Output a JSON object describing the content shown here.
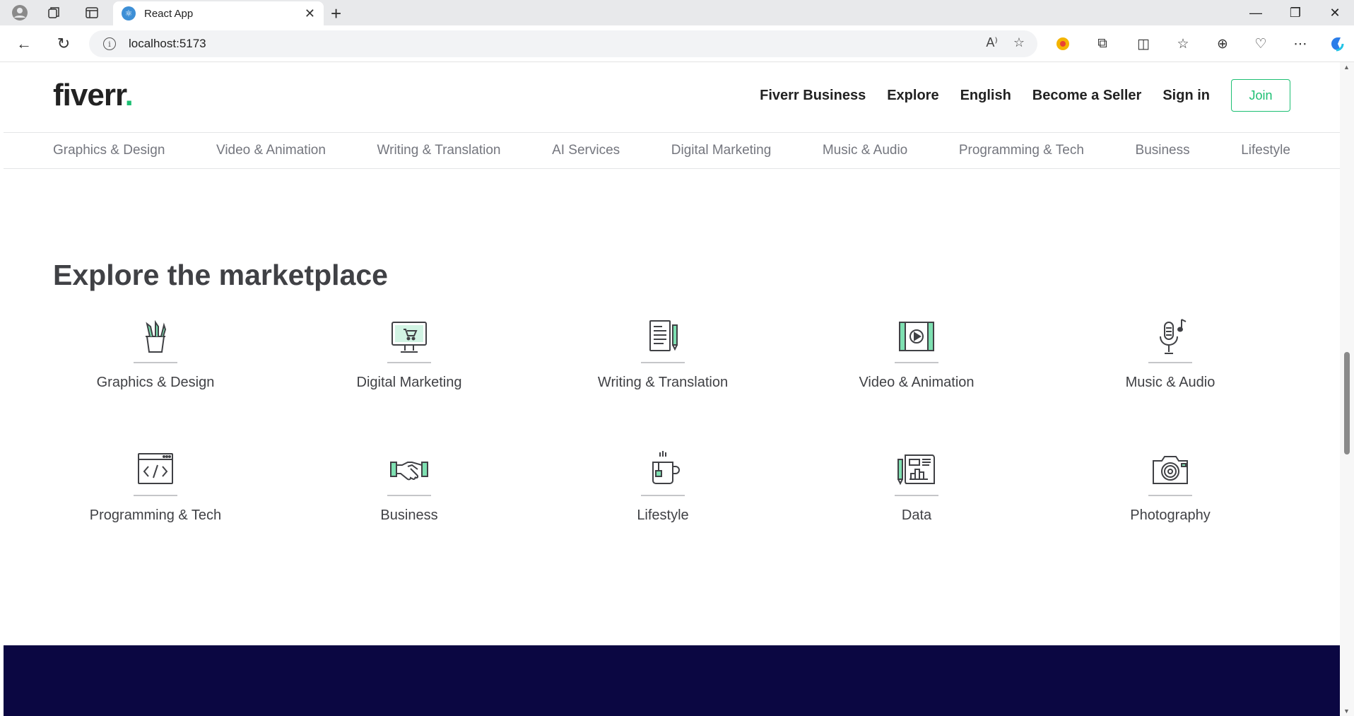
{
  "browser": {
    "tab_title": "React App",
    "url": "localhost:5173"
  },
  "header": {
    "logo_text": "fiverr",
    "logo_dot": ".",
    "nav": [
      "Fiverr Business",
      "Explore",
      "English",
      "Become a Seller",
      "Sign in"
    ],
    "join_label": "Join"
  },
  "categories": [
    "Graphics & Design",
    "Video & Animation",
    "Writing & Translation",
    "AI Services",
    "Digital Marketing",
    "Music & Audio",
    "Programming & Tech",
    "Business",
    "Lifestyle"
  ],
  "marketplace": {
    "title": "Explore the marketplace",
    "items": [
      {
        "label": "Graphics & Design",
        "icon": "pencil-cup-icon"
      },
      {
        "label": "Digital Marketing",
        "icon": "monitor-cart-icon"
      },
      {
        "label": "Writing & Translation",
        "icon": "document-pen-icon"
      },
      {
        "label": "Video & Animation",
        "icon": "film-play-icon"
      },
      {
        "label": "Music & Audio",
        "icon": "microphone-note-icon"
      },
      {
        "label": "Programming & Tech",
        "icon": "code-window-icon"
      },
      {
        "label": "Business",
        "icon": "handshake-icon"
      },
      {
        "label": "Lifestyle",
        "icon": "mug-icon"
      },
      {
        "label": "Data",
        "icon": "report-chart-icon"
      },
      {
        "label": "Photography",
        "icon": "camera-icon"
      }
    ]
  },
  "colors": {
    "brand_green": "#1dbf73",
    "footer_navy": "#0b0742",
    "text_dark": "#404145",
    "text_muted": "#74767e"
  }
}
